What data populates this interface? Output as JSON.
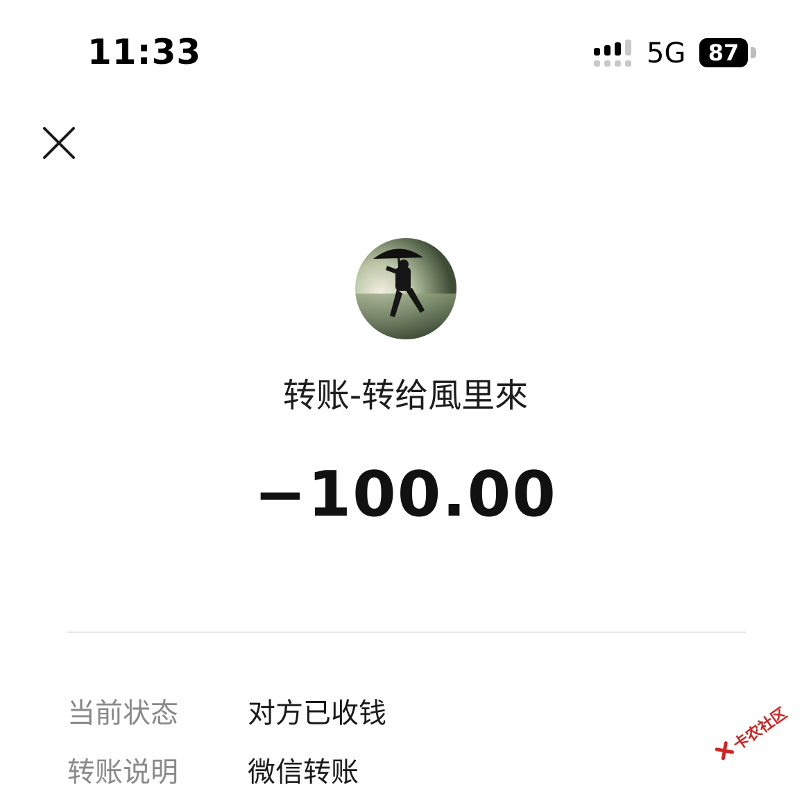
{
  "status_bar": {
    "time": "11:33",
    "network": "5G",
    "battery": "87",
    "signal_icon": "cellular-signal-icon"
  },
  "header": {
    "close_icon": "close-icon"
  },
  "transfer": {
    "title": "转账-转给風里來",
    "amount": "−100.00"
  },
  "details": [
    {
      "label": "当前状态",
      "value": "对方已收钱"
    },
    {
      "label": "转账说明",
      "value": "微信转账"
    }
  ],
  "watermark": {
    "text": "卡农社区"
  },
  "colors": {
    "label_gray": "#8a8a8a",
    "divider": "#e6e6e6",
    "watermark_red": "#d02424"
  }
}
